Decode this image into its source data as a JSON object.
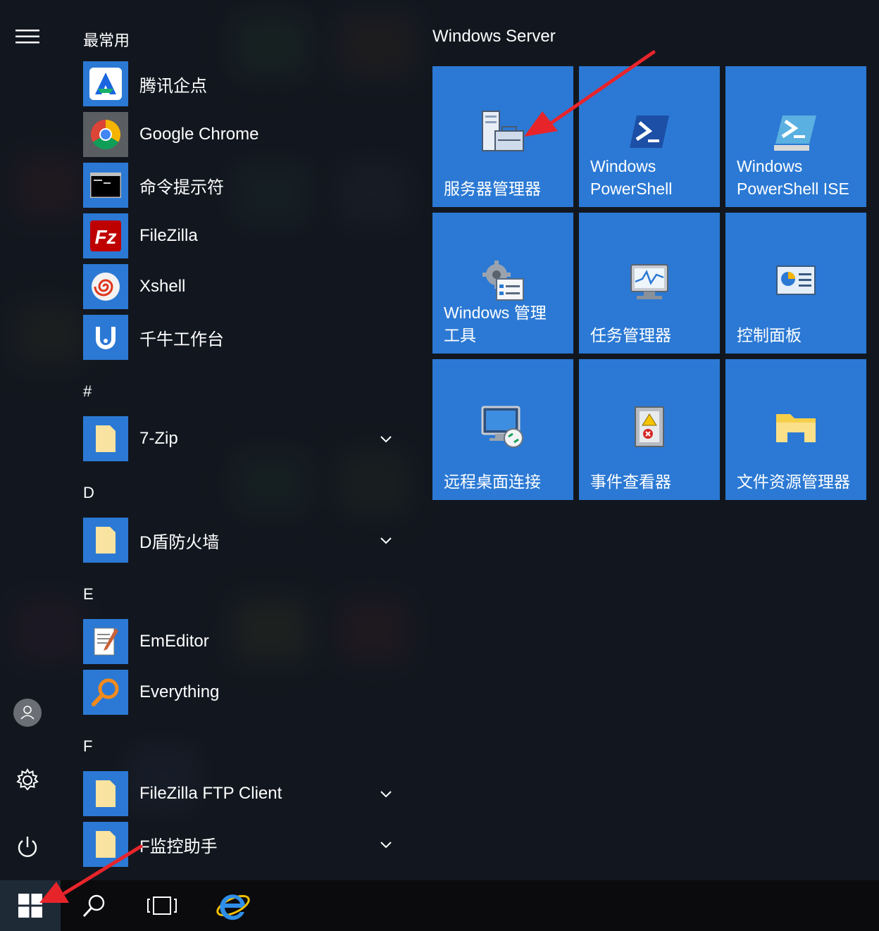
{
  "sections": {
    "frequent": "最常用",
    "tiles_group": "Windows Server"
  },
  "frequent_apps": [
    {
      "label": "腾讯企点",
      "icon": "tencent-qidian-icon"
    },
    {
      "label": "Google Chrome",
      "icon": "chrome-icon"
    },
    {
      "label": "命令提示符",
      "icon": "command-prompt-icon"
    },
    {
      "label": "FileZilla",
      "icon": "filezilla-icon"
    },
    {
      "label": "Xshell",
      "icon": "xshell-icon"
    },
    {
      "label": "千牛工作台",
      "icon": "qianniu-icon"
    }
  ],
  "alpha_groups": [
    {
      "letter": "#",
      "items": [
        {
          "label": "7-Zip",
          "icon": "folder-icon",
          "expandable": true
        }
      ]
    },
    {
      "letter": "D",
      "items": [
        {
          "label": "D盾防火墙",
          "icon": "folder-icon",
          "expandable": true
        }
      ]
    },
    {
      "letter": "E",
      "items": [
        {
          "label": "EmEditor",
          "icon": "emeditor-icon",
          "expandable": false
        },
        {
          "label": "Everything",
          "icon": "everything-icon",
          "expandable": false
        }
      ]
    },
    {
      "letter": "F",
      "items": [
        {
          "label": "FileZilla FTP Client",
          "icon": "folder-icon",
          "expandable": true
        },
        {
          "label": "F监控助手",
          "icon": "folder-icon",
          "expandable": true
        }
      ]
    }
  ],
  "tiles": [
    {
      "label": "服务器管理器",
      "icon": "server-manager-icon"
    },
    {
      "label": "Windows\nPowerShell",
      "icon": "powershell-icon"
    },
    {
      "label": "Windows\nPowerShell ISE",
      "icon": "powershell-ise-icon"
    },
    {
      "label": "Windows 管理\n工具",
      "icon": "admin-tools-icon"
    },
    {
      "label": "任务管理器",
      "icon": "task-manager-icon"
    },
    {
      "label": "控制面板",
      "icon": "control-panel-icon"
    },
    {
      "label": "远程桌面连接",
      "icon": "remote-desktop-icon"
    },
    {
      "label": "事件查看器",
      "icon": "event-viewer-icon"
    },
    {
      "label": "文件资源管理器",
      "icon": "file-explorer-icon"
    }
  ],
  "rail": [
    "hamburger-menu-icon",
    "user-avatar-icon",
    "settings-gear-icon",
    "power-icon"
  ],
  "taskbar": [
    "windows-start-icon",
    "search-icon",
    "task-view-icon",
    "internet-explorer-icon"
  ],
  "colors": {
    "tile": "#2b79d4",
    "annotation_arrow": "#e8242b",
    "taskbar": "#0b0b0d"
  }
}
